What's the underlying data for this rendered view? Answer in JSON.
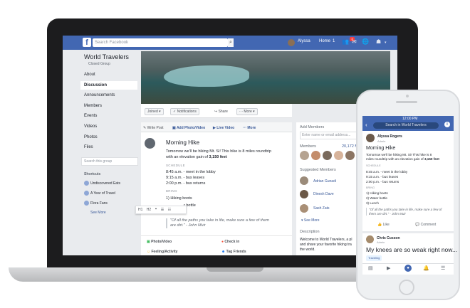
{
  "topbar": {
    "logo": "f",
    "search_placeholder": "Search Facebook",
    "user": "Alyssa",
    "home": "Home",
    "home_count": "1",
    "notif_count": "4"
  },
  "group": {
    "title": "World Travelers",
    "privacy": "Closed Group"
  },
  "nav": {
    "items": [
      "About",
      "Discussion",
      "Announcements",
      "Members",
      "Events",
      "Videos",
      "Photos",
      "Files"
    ],
    "active": "Discussion",
    "search_placeholder": "Search this group"
  },
  "shortcuts": {
    "heading": "Shortcuts",
    "items": [
      "Undiscovered Eats",
      "A Year of Travel",
      "Flora Fans"
    ],
    "see_more": "See More"
  },
  "group_actions": {
    "joined": "Joined",
    "notifications": "Notifications",
    "share": "Share",
    "more": "More"
  },
  "composer": {
    "write_post": "Write Post",
    "add_photo_video": "Add Photo/Video",
    "live_video": "Live Video",
    "more": "More"
  },
  "post": {
    "title": "Morning Hike",
    "line1": "Tomorrow we'll be hiking Mt. Si! This hike is 8 miles roundtrip",
    "line2_prefix": "with an elevation gain of ",
    "line2_bold": "3,150 feet",
    "schedule_label": "SCHEDULE",
    "schedule": [
      "8:45 a.m. - meet in the lobby",
      "9:15 a.m. - bus leaves",
      "2:00 p.m. - bus returns"
    ],
    "bring_label": "BRING",
    "bring": [
      "1)   Hiking boots",
      "r bottle",
      "h"
    ],
    "quote": "\"Of all the paths you take in life, make sure a few of them are dirt.\" - John Muir"
  },
  "format_toolbar": {
    "items": [
      "H1",
      "H2",
      "❝",
      "☰",
      "☷"
    ]
  },
  "post_footer": {
    "photo_video": "Photo/Video",
    "check_in": "Check in",
    "feeling": "Feeling/Activity",
    "tag_friends": "Tag Friends"
  },
  "right": {
    "add_members": "Add Members",
    "add_placeholder": "Enter name or email address...",
    "members_label": "Members",
    "members_count": "20,172 M",
    "suggested": "Suggested Members",
    "suggested_names": [
      "Adrian Gunadi",
      "Dinesh Dave",
      "Sash Zats"
    ],
    "see_more": "See More",
    "description_label": "Description",
    "description": [
      "Welcome to World Travelers, a pl",
      "and share your favorite hiking tra",
      "the world."
    ]
  },
  "mobile": {
    "time": "12:00 PM",
    "search": "Search in World Travelers",
    "author": "Alyssa Rogers",
    "author_sub": "Admin",
    "post_title": "Morning Hike",
    "line1": "Tomorrow we'll be hiking Mt. Si! This hike is 8",
    "line2_prefix": "miles roundtrip with an elevation gain of ",
    "line2_bold": "3,150 feet",
    "schedule_label": "SCHEDULE",
    "schedule": [
      "8:45 a.m. - meet in the lobby",
      "9:15 a.m. - bus leaves",
      "2:00 p.m. - bus returns"
    ],
    "bring_label": "BRING",
    "bring": [
      "1)   Hiking boots",
      "2)   Water bottle",
      "3)   Lunch"
    ],
    "quote": "\"Of all the paths you take in life, make sure a few of them are dirt.\" - John Muir",
    "like": "Like",
    "comment": "Comment",
    "author2": "Chris Cusson",
    "author2_sub": "Admin",
    "post2": "My knees are so weak right now...",
    "tag": "Traveling"
  },
  "colors": {
    "brand": "#4267b2",
    "link": "#385898",
    "background": "#e9ebee"
  }
}
